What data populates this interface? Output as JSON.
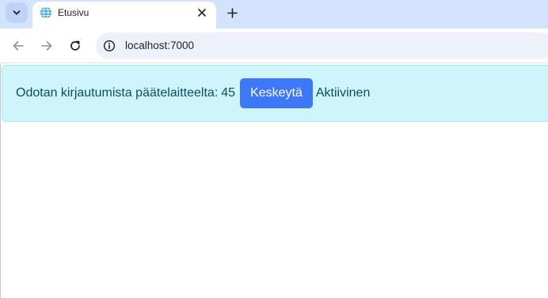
{
  "browser": {
    "tab": {
      "title": "Etusivu"
    },
    "address_bar": {
      "url": "localhost:7000"
    }
  },
  "alert": {
    "message": "Odotan kirjautumista päätelaitteelta:",
    "countdown": "45",
    "cancel_label": "Keskeytä",
    "status": "Aktiivinen"
  },
  "colors": {
    "alert_background": "#cff4fc",
    "alert_text": "#055160",
    "button_background": "#3d78f8",
    "tabstrip_background": "#d3e3fd"
  },
  "icons": [
    "chevron-down-icon",
    "globe-icon",
    "close-icon",
    "plus-icon",
    "back-arrow-icon",
    "forward-arrow-icon",
    "reload-icon",
    "site-info-icon"
  ]
}
